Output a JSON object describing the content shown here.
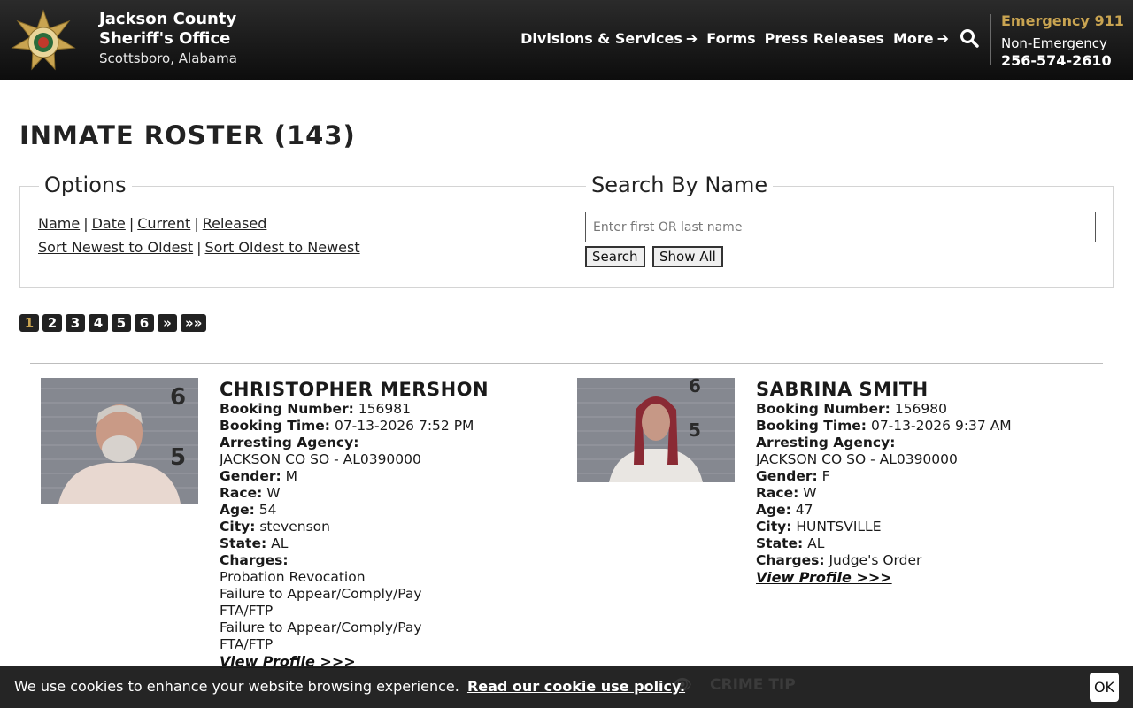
{
  "header": {
    "org_line1": "Jackson County",
    "org_line2": "Sheriff's Office",
    "location": "Scottsboro, Alabama",
    "nav": [
      "Divisions & Services",
      "Forms",
      "Press Releases",
      "More"
    ],
    "emergency_label": "Emergency 911",
    "non_emergency_label": "Non-Emergency",
    "non_emergency_phone": "256-574-2610"
  },
  "page": {
    "title": "INMATE ROSTER (143)"
  },
  "options": {
    "legend": "Options",
    "sort_links": [
      "Name",
      "Date",
      "Current",
      "Released"
    ],
    "order_links": [
      "Sort Newest to Oldest",
      "Sort Oldest to Newest"
    ]
  },
  "search": {
    "legend": "Search By Name",
    "placeholder": "Enter first OR last name",
    "search_button": "Search",
    "show_all_button": "Show All"
  },
  "pagination": [
    "1",
    "2",
    "3",
    "4",
    "5",
    "6",
    "»",
    "»»"
  ],
  "pagination_active": "1",
  "inmates": [
    {
      "name": "CHRISTOPHER MERSHON",
      "booking_number_label": "Booking Number:",
      "booking_number": "156981",
      "booking_time_label": "Booking Time:",
      "booking_time": "07-13-2026 7:52 PM",
      "agency_label": "Arresting Agency:",
      "agency": "JACKSON CO SO - AL0390000",
      "gender_label": "Gender:",
      "gender": "M",
      "race_label": "Race:",
      "race": "W",
      "age_label": "Age:",
      "age": "54",
      "city_label": "City:",
      "city": "stevenson",
      "state_label": "State:",
      "state": "AL",
      "charges_label": "Charges:",
      "charges": [
        "Probation Revocation",
        "Failure to Appear/Comply/Pay",
        "FTA/FTP",
        "Failure to Appear/Comply/Pay",
        "FTA/FTP"
      ],
      "view_profile": "View Profile >>>"
    },
    {
      "name": "SABRINA SMITH",
      "booking_number_label": "Booking Number:",
      "booking_number": "156980",
      "booking_time_label": "Booking Time:",
      "booking_time": "07-13-2026 9:37 AM",
      "agency_label": "Arresting Agency:",
      "agency": "JACKSON CO SO - AL0390000",
      "gender_label": "Gender:",
      "gender": "F",
      "race_label": "Race:",
      "race": "W",
      "age_label": "Age:",
      "age": "47",
      "city_label": "City:",
      "city": "HUNTSVILLE",
      "state_label": "State:",
      "state": "AL",
      "charges_label": "Charges:",
      "charges_inline": "Judge's Order",
      "view_profile": "View Profile >>>"
    }
  ],
  "cookie": {
    "message": "We use cookies to enhance your website browsing experience.",
    "link": "Read our cookie use policy.",
    "ok": "OK",
    "behind_text": "CRIME TIP"
  },
  "colors": {
    "gold": "#c9a451",
    "header_bg": "#111111"
  },
  "icons": {
    "search": "search-icon",
    "arrow": "arrow-right-icon",
    "badge": "sheriff-star-badge"
  }
}
